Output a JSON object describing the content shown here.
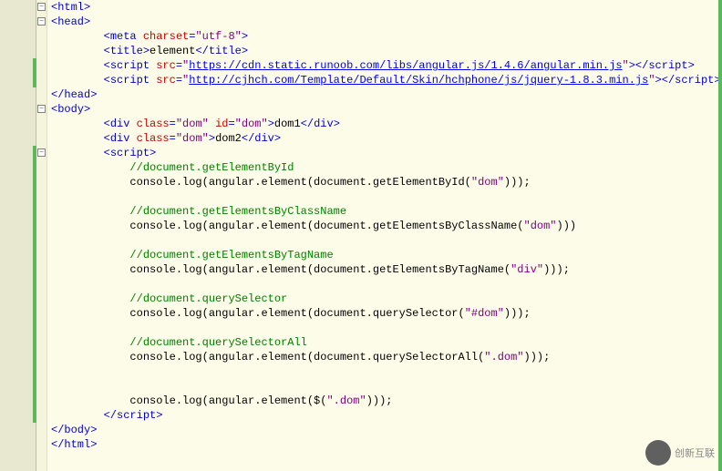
{
  "watermark": {
    "text": "创新互联"
  },
  "lines": [
    {
      "indent": 0,
      "segs": [
        {
          "t": "<",
          "c": "tag"
        },
        {
          "t": "html",
          "c": "tag"
        },
        {
          "t": ">",
          "c": "tag"
        }
      ],
      "fold": "minus"
    },
    {
      "indent": 0,
      "segs": [
        {
          "t": "<",
          "c": "tag"
        },
        {
          "t": "head",
          "c": "tag"
        },
        {
          "t": ">",
          "c": "tag"
        }
      ],
      "fold": "minus"
    },
    {
      "indent": 2,
      "segs": [
        {
          "t": "<",
          "c": "tag"
        },
        {
          "t": "meta",
          "c": "tag"
        },
        {
          "t": " ",
          "c": ""
        },
        {
          "t": "charset",
          "c": "attr"
        },
        {
          "t": "=",
          "c": "tag"
        },
        {
          "t": "\"utf-8\"",
          "c": "str"
        },
        {
          "t": ">",
          "c": "tag"
        }
      ]
    },
    {
      "indent": 2,
      "segs": [
        {
          "t": "<",
          "c": "tag"
        },
        {
          "t": "title",
          "c": "tag"
        },
        {
          "t": ">",
          "c": "tag"
        },
        {
          "t": "element",
          "c": "txt"
        },
        {
          "t": "</",
          "c": "tag"
        },
        {
          "t": "title",
          "c": "tag"
        },
        {
          "t": ">",
          "c": "tag"
        }
      ]
    },
    {
      "indent": 2,
      "segs": [
        {
          "t": "<",
          "c": "tag"
        },
        {
          "t": "script",
          "c": "tag"
        },
        {
          "t": " ",
          "c": ""
        },
        {
          "t": "src",
          "c": "attr"
        },
        {
          "t": "=",
          "c": "tag"
        },
        {
          "t": "\"",
          "c": "str"
        },
        {
          "t": "https://cdn.static.runoob.com/libs/angular.js/1.4.6/angular.min.js",
          "c": "url"
        },
        {
          "t": "\"",
          "c": "str"
        },
        {
          "t": "></",
          "c": "tag"
        },
        {
          "t": "script",
          "c": "tag"
        },
        {
          "t": ">",
          "c": "tag"
        }
      ],
      "mark": true
    },
    {
      "indent": 2,
      "segs": [
        {
          "t": "<",
          "c": "tag"
        },
        {
          "t": "script",
          "c": "tag"
        },
        {
          "t": " ",
          "c": ""
        },
        {
          "t": "src",
          "c": "attr"
        },
        {
          "t": "=",
          "c": "tag"
        },
        {
          "t": "\"",
          "c": "str"
        },
        {
          "t": "http://cjhch.com/Template/Default/Skin/hchphone/js/jquery-1.8.3.min.js",
          "c": "url"
        },
        {
          "t": "\"",
          "c": "str"
        },
        {
          "t": "></",
          "c": "tag"
        },
        {
          "t": "script",
          "c": "tag"
        },
        {
          "t": ">",
          "c": "tag"
        }
      ],
      "mark": true
    },
    {
      "indent": 0,
      "segs": [
        {
          "t": "</",
          "c": "tag"
        },
        {
          "t": "head",
          "c": "tag"
        },
        {
          "t": ">",
          "c": "tag"
        }
      ]
    },
    {
      "indent": 0,
      "segs": [
        {
          "t": "<",
          "c": "tag"
        },
        {
          "t": "body",
          "c": "tag"
        },
        {
          "t": ">",
          "c": "tag"
        }
      ],
      "fold": "minus"
    },
    {
      "indent": 2,
      "segs": [
        {
          "t": "<",
          "c": "tag"
        },
        {
          "t": "div",
          "c": "tag"
        },
        {
          "t": " ",
          "c": ""
        },
        {
          "t": "class",
          "c": "attr"
        },
        {
          "t": "=",
          "c": "tag"
        },
        {
          "t": "\"dom\"",
          "c": "str"
        },
        {
          "t": " ",
          "c": ""
        },
        {
          "t": "id",
          "c": "attr"
        },
        {
          "t": "=",
          "c": "tag"
        },
        {
          "t": "\"dom\"",
          "c": "str"
        },
        {
          "t": ">",
          "c": "tag"
        },
        {
          "t": "dom1",
          "c": "txt"
        },
        {
          "t": "</",
          "c": "tag"
        },
        {
          "t": "div",
          "c": "tag"
        },
        {
          "t": ">",
          "c": "tag"
        }
      ]
    },
    {
      "indent": 2,
      "segs": [
        {
          "t": "<",
          "c": "tag"
        },
        {
          "t": "div",
          "c": "tag"
        },
        {
          "t": " ",
          "c": ""
        },
        {
          "t": "class",
          "c": "attr"
        },
        {
          "t": "=",
          "c": "tag"
        },
        {
          "t": "\"dom\"",
          "c": "str"
        },
        {
          "t": ">",
          "c": "tag"
        },
        {
          "t": "dom2",
          "c": "txt"
        },
        {
          "t": "</",
          "c": "tag"
        },
        {
          "t": "div",
          "c": "tag"
        },
        {
          "t": ">",
          "c": "tag"
        }
      ]
    },
    {
      "indent": 2,
      "segs": [
        {
          "t": "<",
          "c": "tag"
        },
        {
          "t": "script",
          "c": "tag"
        },
        {
          "t": ">",
          "c": "tag"
        }
      ],
      "fold": "minus",
      "mark": true
    },
    {
      "indent": 3,
      "segs": [
        {
          "t": "//document.getElementById",
          "c": "comment"
        }
      ],
      "mark": true
    },
    {
      "indent": 3,
      "segs": [
        {
          "t": "console.log(angular.element(document.getElementById(",
          "c": "txt"
        },
        {
          "t": "\"dom\"",
          "c": "str"
        },
        {
          "t": ")));",
          "c": "txt"
        }
      ],
      "mark": true
    },
    {
      "indent": 3,
      "segs": [],
      "mark": true
    },
    {
      "indent": 3,
      "segs": [
        {
          "t": "//document.getElementsByClassName",
          "c": "comment"
        }
      ],
      "mark": true
    },
    {
      "indent": 3,
      "segs": [
        {
          "t": "console.log(angular.element(document.getElementsByClassName(",
          "c": "txt"
        },
        {
          "t": "\"dom\"",
          "c": "str"
        },
        {
          "t": ")))",
          "c": "txt"
        }
      ],
      "mark": true
    },
    {
      "indent": 3,
      "segs": [],
      "mark": true
    },
    {
      "indent": 3,
      "segs": [
        {
          "t": "//document.getElementsByTagName",
          "c": "comment"
        }
      ],
      "mark": true
    },
    {
      "indent": 3,
      "segs": [
        {
          "t": "console.log(angular.element(document.getElementsByTagName(",
          "c": "txt"
        },
        {
          "t": "\"div\"",
          "c": "str"
        },
        {
          "t": ")));",
          "c": "txt"
        }
      ],
      "mark": true
    },
    {
      "indent": 3,
      "segs": [],
      "mark": true
    },
    {
      "indent": 3,
      "segs": [
        {
          "t": "//document.querySelector",
          "c": "comment"
        }
      ],
      "mark": true
    },
    {
      "indent": 3,
      "segs": [
        {
          "t": "console.log(angular.element(document.querySelector(",
          "c": "txt"
        },
        {
          "t": "\"#dom\"",
          "c": "str"
        },
        {
          "t": ")));",
          "c": "txt"
        }
      ],
      "mark": true
    },
    {
      "indent": 3,
      "segs": [],
      "mark": true
    },
    {
      "indent": 3,
      "segs": [
        {
          "t": "//document.querySelectorAll",
          "c": "comment"
        }
      ],
      "mark": true
    },
    {
      "indent": 3,
      "segs": [
        {
          "t": "console.log(angular.element(document.querySelectorAll(",
          "c": "txt"
        },
        {
          "t": "\".dom\"",
          "c": "str"
        },
        {
          "t": ")));",
          "c": "txt"
        }
      ],
      "mark": true
    },
    {
      "indent": 3,
      "segs": [],
      "mark": true,
      "cursor": true
    },
    {
      "indent": 3,
      "segs": [],
      "mark": true
    },
    {
      "indent": 3,
      "segs": [
        {
          "t": "console.log(angular.element($(",
          "c": "txt"
        },
        {
          "t": "\".dom\"",
          "c": "str"
        },
        {
          "t": ")));",
          "c": "txt"
        }
      ],
      "mark": true
    },
    {
      "indent": 2,
      "segs": [
        {
          "t": "</",
          "c": "tag"
        },
        {
          "t": "script",
          "c": "tag"
        },
        {
          "t": ">",
          "c": "tag"
        }
      ],
      "mark": true
    },
    {
      "indent": 0,
      "segs": [
        {
          "t": "</",
          "c": "tag"
        },
        {
          "t": "body",
          "c": "tag"
        },
        {
          "t": ">",
          "c": "tag"
        }
      ]
    },
    {
      "indent": 0,
      "segs": [
        {
          "t": "</",
          "c": "tag"
        },
        {
          "t": "html",
          "c": "tag"
        },
        {
          "t": ">",
          "c": "tag"
        }
      ]
    }
  ]
}
